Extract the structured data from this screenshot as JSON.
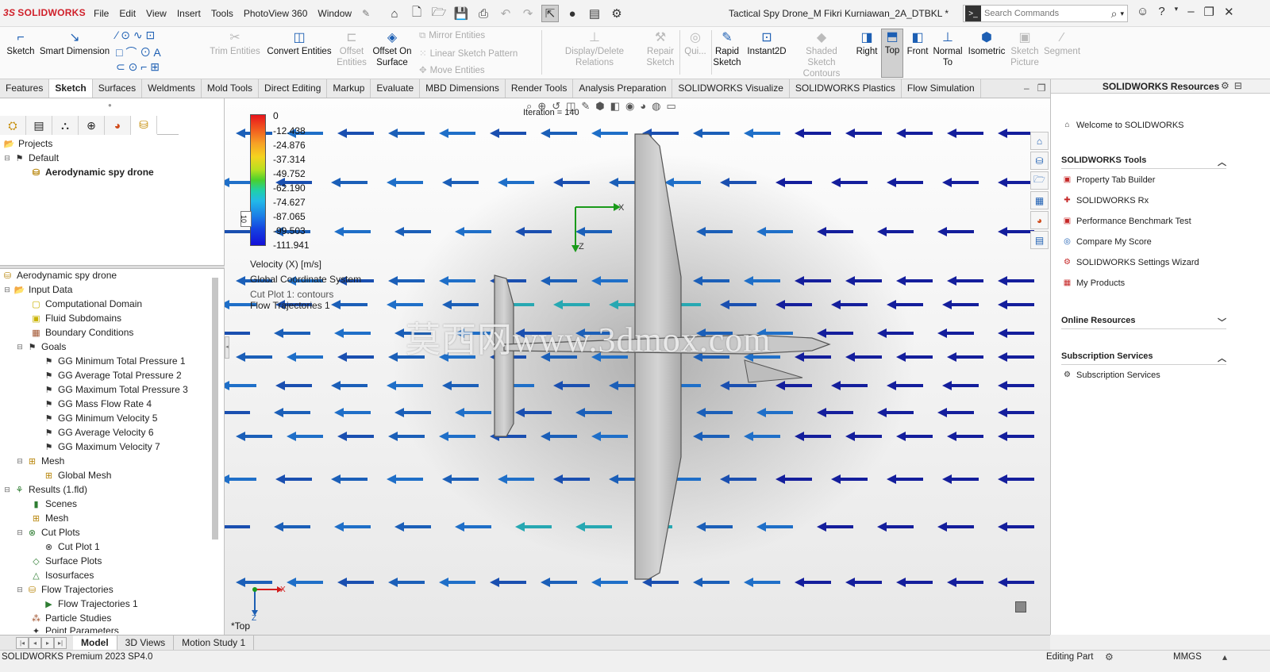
{
  "app": {
    "brand": "SOLIDWORKS",
    "document_title": "Tactical Spy Drone_M Fikri Kurniawan_2A_DTBKL *",
    "menu": [
      "File",
      "Edit",
      "View",
      "Insert",
      "Tools",
      "PhotoView 360",
      "Window"
    ]
  },
  "search": {
    "placeholder": "Search Commands"
  },
  "commands": {
    "sketch": "Sketch",
    "smart_dimension": "Smart Dimension",
    "trim_entities": "Trim Entities",
    "convert_entities": "Convert Entities",
    "offset_entities": "Offset Entities",
    "offset_on_surface": "Offset On Surface",
    "mirror_entities": "Mirror Entities",
    "linear_sketch_pattern": "Linear Sketch Pattern",
    "move_entities": "Move Entities",
    "display_delete_relations": "Display/Delete Relations",
    "repair_sketch": "Repair Sketch",
    "quick_snaps": "Qui...",
    "rapid_sketch": "Rapid Sketch",
    "instant2d": "Instant2D",
    "shaded_sketch_contours": "Shaded Sketch Contours",
    "right": "Right",
    "top": "Top",
    "front": "Front",
    "normal_to": "Normal To",
    "isometric": "Isometric",
    "sketch_picture": "Sketch Picture",
    "segment": "Segment"
  },
  "tabs": [
    "Features",
    "Sketch",
    "Surfaces",
    "Weldments",
    "Mold Tools",
    "Direct Editing",
    "Markup",
    "Evaluate",
    "MBD Dimensions",
    "Render Tools",
    "Analysis Preparation",
    "SOLIDWORKS Visualize",
    "SOLIDWORKS Plastics",
    "Flow Simulation"
  ],
  "active_tab": "Sketch",
  "project_tree": {
    "root": "Projects",
    "default": "Default",
    "project": "Aerodynamic spy drone"
  },
  "analysis_tree": {
    "root": "Aerodynamic spy drone",
    "input_data": "Input Data",
    "computational_domain": "Computational Domain",
    "fluid_subdomains": "Fluid Subdomains",
    "boundary_conditions": "Boundary Conditions",
    "goals": "Goals",
    "goal_items": [
      "GG Minimum Total Pressure 1",
      "GG Average Total Pressure 2",
      "GG Maximum Total Pressure 3",
      "GG Mass Flow Rate 4",
      "GG Minimum Velocity 5",
      "GG Average Velocity 6",
      "GG Maximum Velocity 7"
    ],
    "mesh": "Mesh",
    "global_mesh": "Global Mesh",
    "results": "Results (1.fld)",
    "scenes": "Scenes",
    "results_mesh": "Mesh",
    "cut_plots": "Cut Plots",
    "cut_plot_1": "Cut Plot 1",
    "surface_plots": "Surface Plots",
    "isosurfaces": "Isosurfaces",
    "flow_trajectories": "Flow Trajectories",
    "flow_trajectories_1": "Flow Trajectories 1",
    "particle_studies": "Particle Studies",
    "point_parameters": "Point Parameters"
  },
  "legend": {
    "values": [
      "0",
      "-12.438",
      "-24.876",
      "-37.314",
      "-49.752",
      "-62.190",
      "-74.627",
      "-87.065",
      "-99.503",
      "-111.941"
    ],
    "scale_box": "10",
    "quantity": "Velocity (X) [m/s]",
    "cs": "Global Coordinate System",
    "plot1": "Cut Plot 1: contours",
    "plot2": "Flow Trajectories 1",
    "iteration": "Iteration = 140"
  },
  "viewport": {
    "view_name": "*Top",
    "watermark": "莫西网www.3dmox.com",
    "axis_x": "X",
    "axis_z": "Z"
  },
  "resources": {
    "header": "SOLIDWORKS Resources",
    "welcome": "Welcome to SOLIDWORKS",
    "tools_title": "SOLIDWORKS Tools",
    "tools": [
      "Property Tab Builder",
      "SOLIDWORKS Rx",
      "Performance Benchmark Test",
      "Compare My Score",
      "SOLIDWORKS Settings Wizard",
      "My Products"
    ],
    "online_title": "Online Resources",
    "subscription_title": "Subscription Services",
    "subscription_item": "Subscription Services"
  },
  "bottom_tabs": [
    "Model",
    "3D Views",
    "Motion Study 1"
  ],
  "status": {
    "product": "SOLIDWORKS Premium 2023 SP4.0",
    "mode": "Editing Part",
    "units": "MMGS"
  },
  "colors": {
    "brand": "#d0202a",
    "accent": "#1d5fb3"
  }
}
